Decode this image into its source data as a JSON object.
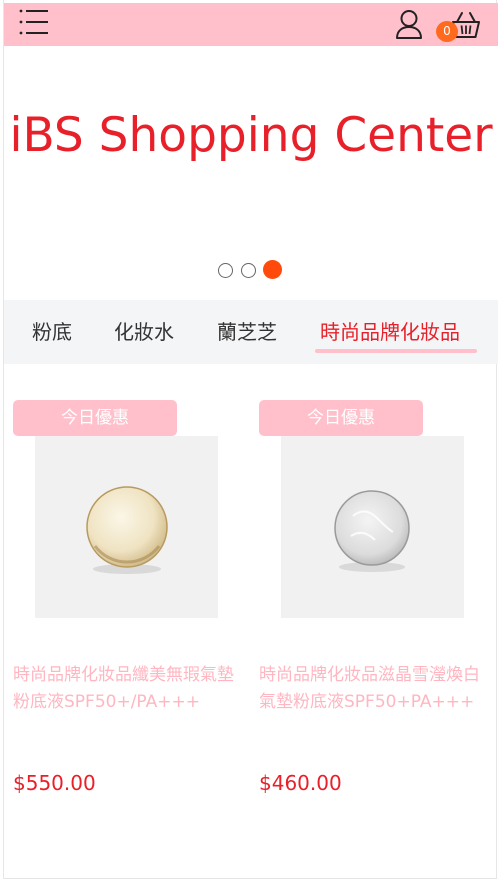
{
  "header": {
    "icons": [
      "menu-icon",
      "user-icon",
      "cart-icon"
    ],
    "cart_count": "0",
    "bar_color": "#ffc0cb",
    "badge_color": "#ff6a1f"
  },
  "hero": {
    "title": "iBS Shopping Center",
    "title_color": "#e8202a",
    "slide_count": 3,
    "active_slide": 3,
    "active_dot_color": "#ff4a0c"
  },
  "category_tabs": {
    "items": [
      {
        "label": "粉底"
      },
      {
        "label": "化妝水"
      },
      {
        "label": "蘭芝芝"
      },
      {
        "label": "時尚品牌化妝品"
      }
    ],
    "active_index": 3,
    "active_color": "#e8202a"
  },
  "products": [
    {
      "badge": "今日優惠",
      "name": "時尚品牌化妝品纖美無瑕氣墊粉底液SPF50+/PA+++",
      "price": "$550.00",
      "image": "cushion-compact-gold"
    },
    {
      "badge": "今日優惠",
      "name": "時尚品牌化妝品滋晶雪瀅煥白氣墊粉底液SPF50+PA+++",
      "price": "$460.00",
      "image": "cushion-compact-silver"
    }
  ]
}
